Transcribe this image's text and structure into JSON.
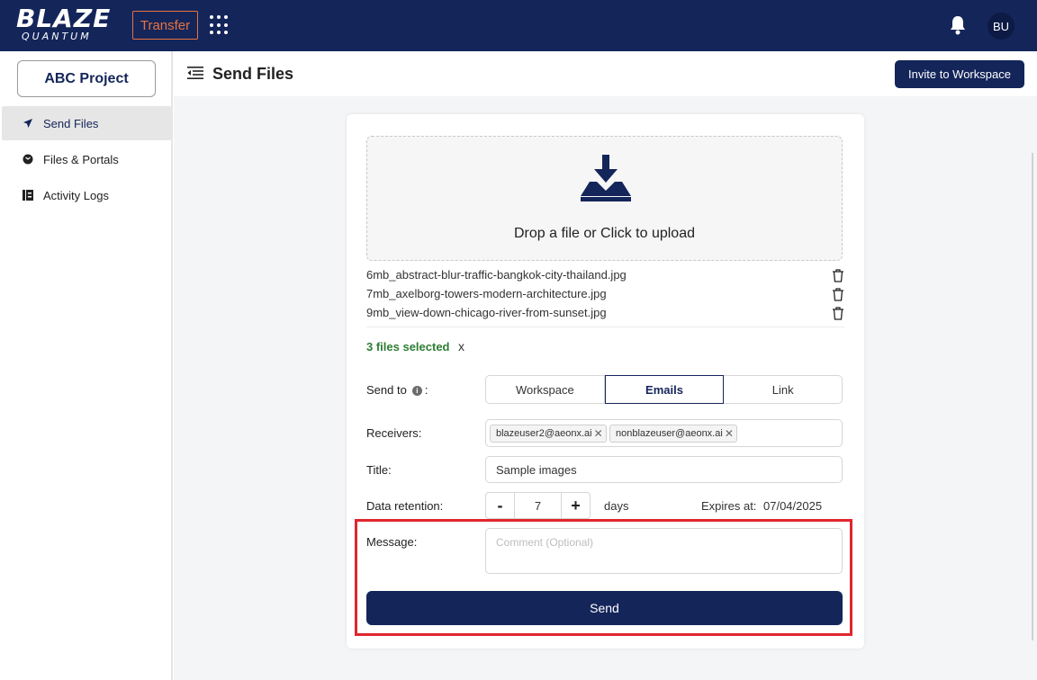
{
  "brand": {
    "line1": "BLAZE",
    "line2": "QUANTUM"
  },
  "topbar": {
    "transfer_label": "Transfer",
    "avatar_initials": "BU"
  },
  "sidebar": {
    "project_label": "ABC Project",
    "items": [
      {
        "label": "Send Files",
        "icon": "send-icon",
        "active": true
      },
      {
        "label": "Files & Portals",
        "icon": "portal-icon",
        "active": false
      },
      {
        "label": "Activity Logs",
        "icon": "logs-icon",
        "active": false
      }
    ]
  },
  "header": {
    "title": "Send Files",
    "invite_label": "Invite to Workspace"
  },
  "upload": {
    "dropzone_text": "Drop a file or Click to upload",
    "files": [
      "6mb_abstract-blur-traffic-bangkok-city-thailand.jpg",
      "7mb_axelborg-towers-modern-architecture.jpg",
      "9mb_view-down-chicago-river-from-sunset.jpg"
    ],
    "selected_text": "3 files selected",
    "clear_label": "x"
  },
  "form": {
    "send_to_label": "Send to",
    "send_to_colon": ":",
    "send_to_options": [
      "Workspace",
      "Emails",
      "Link"
    ],
    "send_to_selected": "Emails",
    "receivers_label": "Receivers:",
    "receivers": [
      "blazeuser2@aeonx.ai",
      "nonblazeuser@aeonx.ai"
    ],
    "title_label": "Title:",
    "title_value": "Sample images",
    "retention_label": "Data retention:",
    "retention_value": "7",
    "retention_unit": "days",
    "decrement_label": "-",
    "increment_label": "+",
    "expires_label": "Expires at:",
    "expires_value": "07/04/2025",
    "message_label": "Message:",
    "message_placeholder": "Comment (Optional)",
    "send_label": "Send"
  },
  "colors": {
    "brand_navy": "#14255a",
    "accent_orange": "#e8733f",
    "success_green": "#2e7d32",
    "highlight_red": "#e0262d"
  }
}
